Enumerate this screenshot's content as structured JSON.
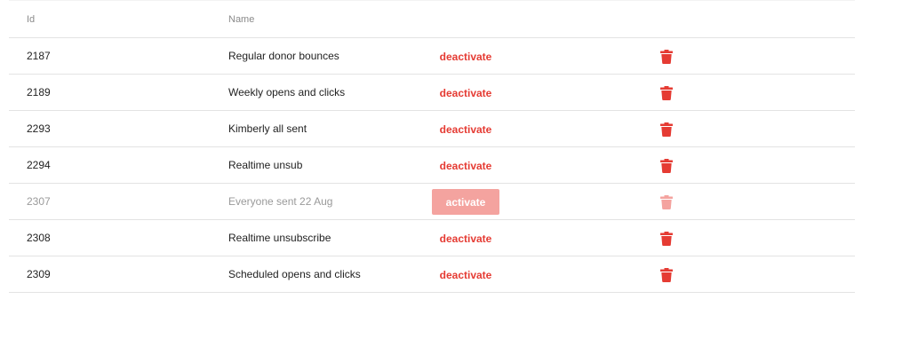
{
  "table": {
    "headers": {
      "id": "Id",
      "name": "Name"
    },
    "rows": [
      {
        "id": "2187",
        "name": "Regular donor bounces",
        "action": "deactivate",
        "status": "active"
      },
      {
        "id": "2189",
        "name": "Weekly opens and clicks",
        "action": "deactivate",
        "status": "active"
      },
      {
        "id": "2293",
        "name": "Kimberly all sent",
        "action": "deactivate",
        "status": "active"
      },
      {
        "id": "2294",
        "name": "Realtime unsub",
        "action": "deactivate",
        "status": "active"
      },
      {
        "id": "2307",
        "name": "Everyone sent 22 Aug",
        "action": "activate",
        "status": "inactive"
      },
      {
        "id": "2308",
        "name": "Realtime unsubscribe",
        "action": "deactivate",
        "status": "active"
      },
      {
        "id": "2309",
        "name": "Scheduled opens and clicks",
        "action": "deactivate",
        "status": "active"
      }
    ]
  },
  "icons": {
    "delete": "trash-icon"
  },
  "colors": {
    "accent_red": "#e53b33",
    "activate_bg": "#f4a39f",
    "muted_text": "#9a9a9a"
  }
}
